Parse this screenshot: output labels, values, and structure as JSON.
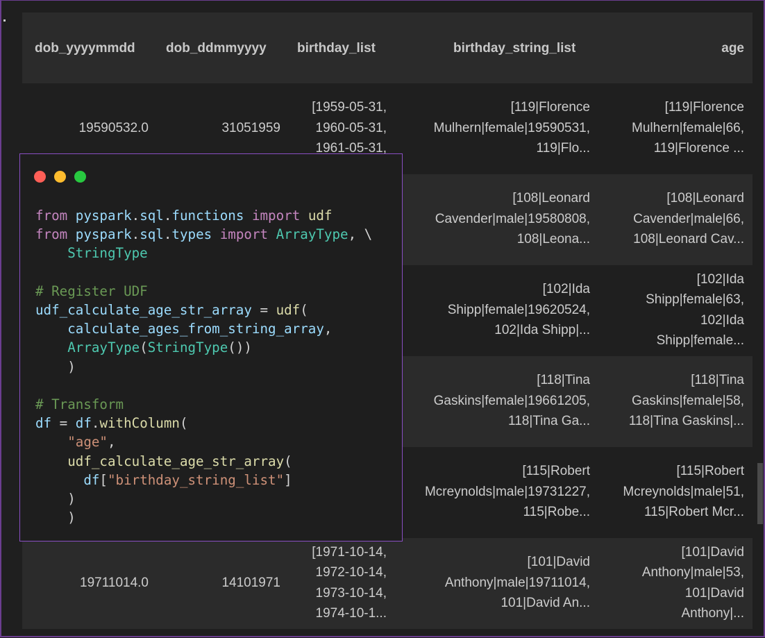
{
  "table": {
    "columns": [
      "dob_yyyymmdd",
      "dob_ddmmyyyy",
      "birthday_list",
      "birthday_string_list",
      "age"
    ],
    "rows": [
      {
        "dob_yyyymmdd": [
          "19590532.0"
        ],
        "dob_ddmmyyyy": [
          "31051959"
        ],
        "birthday_list": [
          "[1959-05-31,",
          "1960-05-31,",
          "1961-05-31,"
        ],
        "birthday_string_list": [
          "[119|Florence",
          "Mulhern|female|19590531,",
          "119|Flo..."
        ],
        "age": [
          "[119|Florence",
          "Mulhern|female|66,",
          "119|Florence ..."
        ]
      },
      {
        "dob_yyyymmdd": [],
        "dob_ddmmyyyy": [],
        "birthday_list": [],
        "birthday_string_list": [
          "[108|Leonard",
          "Cavender|male|19580808,",
          "108|Leona..."
        ],
        "age": [
          "[108|Leonard",
          "Cavender|male|66,",
          "108|Leonard Cav..."
        ]
      },
      {
        "dob_yyyymmdd": [],
        "dob_ddmmyyyy": [],
        "birthday_list": [],
        "birthday_string_list": [
          "[102|Ida",
          "Shipp|female|19620524,",
          "102|Ida Shipp|..."
        ],
        "age": [
          "[102|Ida",
          "Shipp|female|63,",
          "102|Ida",
          "Shipp|female..."
        ]
      },
      {
        "dob_yyyymmdd": [],
        "dob_ddmmyyyy": [],
        "birthday_list": [],
        "birthday_string_list": [
          "[118|Tina",
          "Gaskins|female|19661205,",
          "118|Tina Ga..."
        ],
        "age": [
          "[118|Tina",
          "Gaskins|female|58,",
          "118|Tina Gaskins|..."
        ]
      },
      {
        "dob_yyyymmdd": [],
        "dob_ddmmyyyy": [],
        "birthday_list": [],
        "birthday_string_list": [
          "[115|Robert",
          "Mcreynolds|male|19731227,",
          "115|Robe..."
        ],
        "age": [
          "[115|Robert",
          "Mcreynolds|male|51,",
          "115|Robert Mcr..."
        ]
      },
      {
        "dob_yyyymmdd": [
          "19711014.0"
        ],
        "dob_ddmmyyyy": [
          "14101971"
        ],
        "birthday_list": [
          "[1971-10-14,",
          "1972-10-14,",
          "1973-10-14,",
          "1974-10-1..."
        ],
        "birthday_string_list": [
          "[101|David",
          "Anthony|male|19711014,",
          "101|David An..."
        ],
        "age": [
          "[101|David",
          "Anthony|male|53,",
          "101|David",
          "Anthony|..."
        ]
      }
    ]
  },
  "editor": {
    "window_controls": [
      "close",
      "minimize",
      "maximize"
    ],
    "code_lines": [
      [
        [
          "kw",
          "from "
        ],
        [
          "vr",
          "pyspark"
        ],
        [
          "pl",
          "."
        ],
        [
          "vr",
          "sql"
        ],
        [
          "pl",
          "."
        ],
        [
          "vr",
          "functions"
        ],
        [
          "kw",
          " import "
        ],
        [
          "fn",
          "udf"
        ]
      ],
      [
        [
          "kw",
          "from "
        ],
        [
          "vr",
          "pyspark"
        ],
        [
          "pl",
          "."
        ],
        [
          "vr",
          "sql"
        ],
        [
          "pl",
          "."
        ],
        [
          "vr",
          "types"
        ],
        [
          "kw",
          " import "
        ],
        [
          "ty",
          "ArrayType"
        ],
        [
          "pl",
          ", \\"
        ]
      ],
      [
        [
          "pl",
          "    "
        ],
        [
          "ty",
          "StringType"
        ]
      ],
      [],
      [
        [
          "cm",
          "# Register UDF"
        ]
      ],
      [
        [
          "vr",
          "udf_calculate_age_str_array"
        ],
        [
          "pl",
          " = "
        ],
        [
          "fn",
          "udf"
        ],
        [
          "pl",
          "("
        ]
      ],
      [
        [
          "pl",
          "    "
        ],
        [
          "vr",
          "calculate_ages_from_string_array"
        ],
        [
          "pl",
          ","
        ]
      ],
      [
        [
          "pl",
          "    "
        ],
        [
          "ty",
          "ArrayType"
        ],
        [
          "pl",
          "("
        ],
        [
          "ty",
          "StringType"
        ],
        [
          "pl",
          "())"
        ]
      ],
      [
        [
          "pl",
          "    )"
        ]
      ],
      [],
      [
        [
          "cm",
          "# Transform"
        ]
      ],
      [
        [
          "vr",
          "df"
        ],
        [
          "pl",
          " = "
        ],
        [
          "vr",
          "df"
        ],
        [
          "pl",
          "."
        ],
        [
          "fn",
          "withColumn"
        ],
        [
          "pl",
          "("
        ]
      ],
      [
        [
          "pl",
          "    "
        ],
        [
          "st",
          "\"age\""
        ],
        [
          "pl",
          ","
        ]
      ],
      [
        [
          "pl",
          "    "
        ],
        [
          "fn",
          "udf_calculate_age_str_array"
        ],
        [
          "pl",
          "("
        ]
      ],
      [
        [
          "pl",
          "      "
        ],
        [
          "vr",
          "df"
        ],
        [
          "pl",
          "["
        ],
        [
          "st",
          "\"birthday_string_list\""
        ],
        [
          "pl",
          "]"
        ]
      ],
      [
        [
          "pl",
          "    )"
        ]
      ],
      [
        [
          "pl",
          "    )"
        ]
      ]
    ]
  }
}
